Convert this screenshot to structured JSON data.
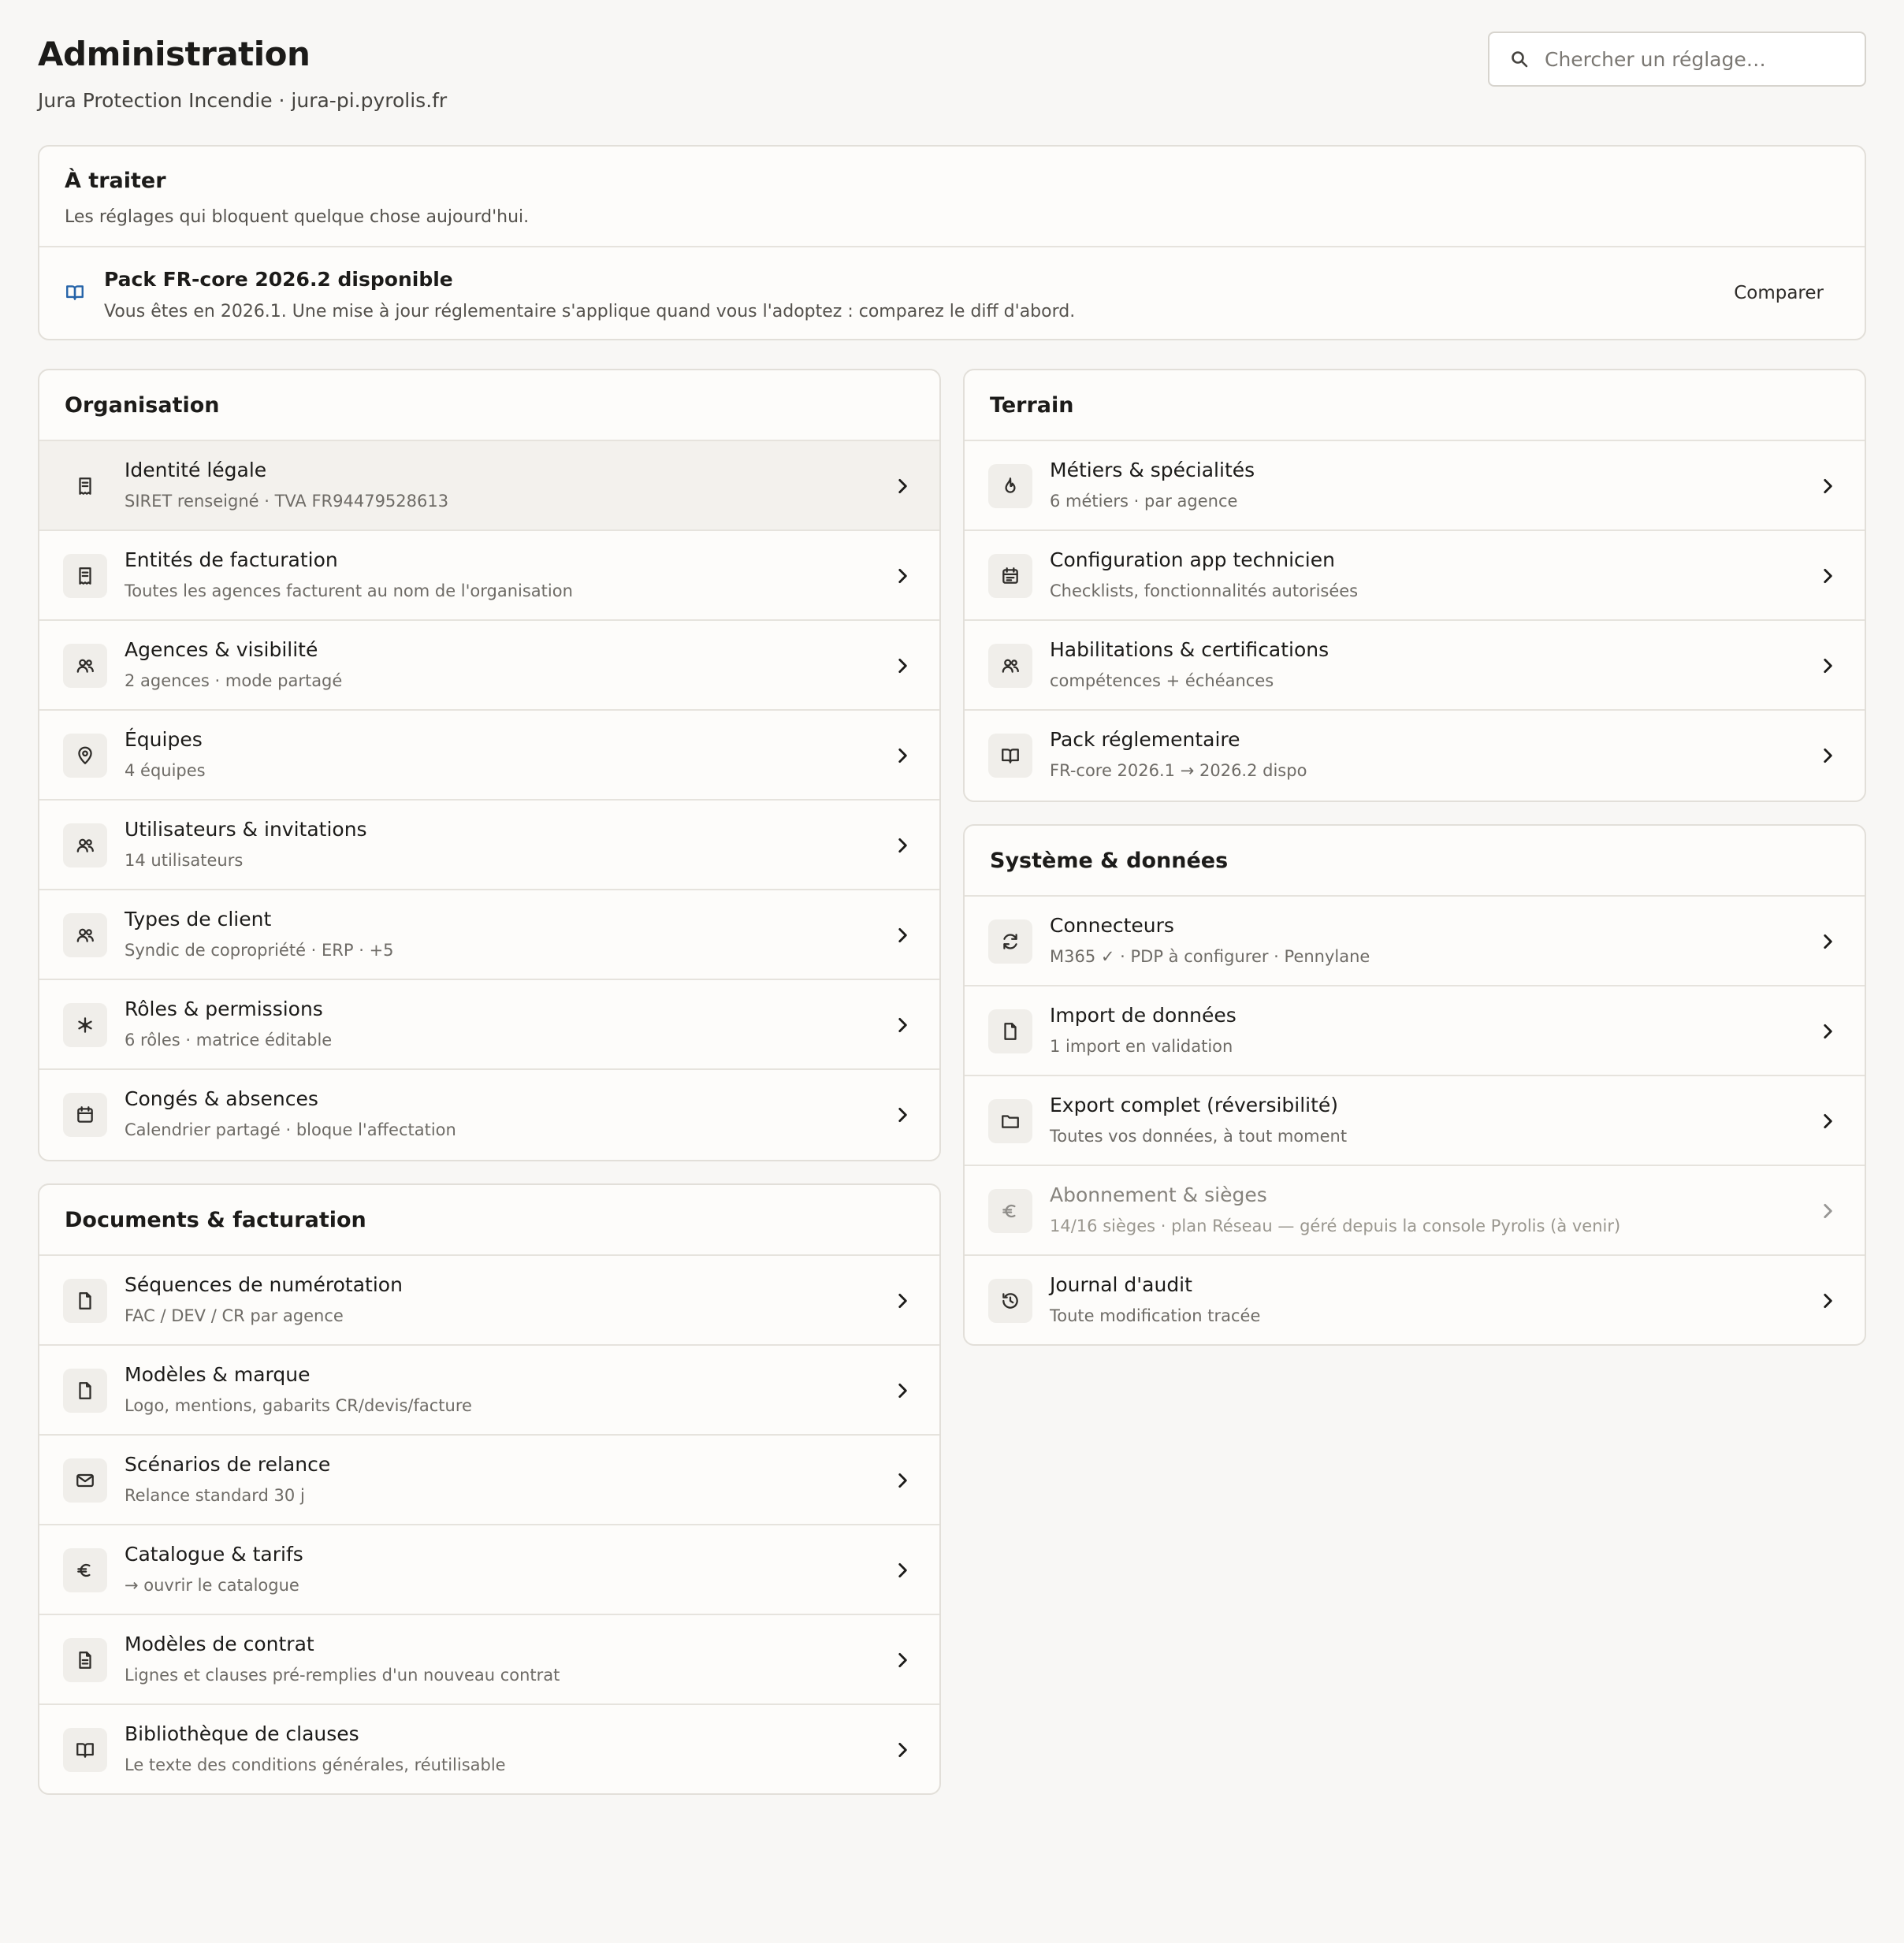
{
  "header": {
    "title": "Administration",
    "subtitle": "Jura Protection Incendie · jura-pi.pyrolis.fr"
  },
  "search": {
    "placeholder": "Chercher un réglage…",
    "icon": "search-icon"
  },
  "colors": {
    "accent": "#2563a8",
    "background": "#f8f7f5",
    "card": "#fdfcfa",
    "border": "#e2dfd9"
  },
  "todo": {
    "title": "À traiter",
    "description": "Les réglages qui bloquent quelque chose aujourd'hui.",
    "item": {
      "icon": "book-open-icon",
      "title": "Pack FR-core 2026.2 disponible",
      "description": "Vous êtes en 2026.1. Une mise à jour réglementaire s'applique quand vous l'adoptez : comparez le diff d'abord.",
      "action_label": "Comparer"
    }
  },
  "organisation": {
    "title": "Organisation",
    "items": [
      {
        "icon": "receipt-icon",
        "title": "Identité légale",
        "subtitle": "SIRET renseigné · TVA FR94479528613"
      },
      {
        "icon": "receipt-icon",
        "title": "Entités de facturation",
        "subtitle": "Toutes les agences facturent au nom de l'organisation"
      },
      {
        "icon": "users-icon",
        "title": "Agences & visibilité",
        "subtitle": "2 agences · mode partagé"
      },
      {
        "icon": "map-pin-icon",
        "title": "Équipes",
        "subtitle": "4 équipes"
      },
      {
        "icon": "users-icon",
        "title": "Utilisateurs & invitations",
        "subtitle": "14 utilisateurs"
      },
      {
        "icon": "users-icon",
        "title": "Types de client",
        "subtitle": "Syndic de copropriété · ERP · +5"
      },
      {
        "icon": "asterisk-icon",
        "title": "Rôles & permissions",
        "subtitle": "6 rôles · matrice éditable"
      },
      {
        "icon": "calendar-icon",
        "title": "Congés & absences",
        "subtitle": "Calendrier partagé · bloque l'affectation"
      }
    ]
  },
  "documents": {
    "title": "Documents & facturation",
    "items": [
      {
        "icon": "file-icon",
        "title": "Séquences de numérotation",
        "subtitle": "FAC / DEV / CR par agence"
      },
      {
        "icon": "file-icon",
        "title": "Modèles & marque",
        "subtitle": "Logo, mentions, gabarits CR/devis/facture"
      },
      {
        "icon": "mail-icon",
        "title": "Scénarios de relance",
        "subtitle": "Relance standard 30 j"
      },
      {
        "icon": "euro-icon",
        "title": "Catalogue & tarifs",
        "subtitle": "→ ouvrir le catalogue"
      },
      {
        "icon": "file-text-icon",
        "title": "Modèles de contrat",
        "subtitle": "Lignes et clauses pré-remplies d'un nouveau contrat"
      },
      {
        "icon": "book-open-icon",
        "title": "Bibliothèque de clauses",
        "subtitle": "Le texte des conditions générales, réutilisable"
      }
    ]
  },
  "terrain": {
    "title": "Terrain",
    "items": [
      {
        "icon": "flame-icon",
        "title": "Métiers & spécialités",
        "subtitle": "6 métiers · par agence"
      },
      {
        "icon": "calendar-check-icon",
        "title": "Configuration app technicien",
        "subtitle": "Checklists, fonctionnalités autorisées"
      },
      {
        "icon": "users-icon",
        "title": "Habilitations & certifications",
        "subtitle": "compétences + échéances"
      },
      {
        "icon": "book-open-icon",
        "title": "Pack réglementaire",
        "subtitle": "FR-core 2026.1 → 2026.2 dispo"
      }
    ]
  },
  "systeme": {
    "title": "Système & données",
    "items": [
      {
        "icon": "sync-icon",
        "title": "Connecteurs",
        "subtitle": "M365 ✓ · PDP à configurer · Pennylane"
      },
      {
        "icon": "file-icon",
        "title": "Import de données",
        "subtitle": "1 import en validation"
      },
      {
        "icon": "folder-icon",
        "title": "Export complet (réversibilité)",
        "subtitle": "Toutes vos données, à tout moment"
      },
      {
        "icon": "euro-icon",
        "title": "Abonnement & sièges",
        "subtitle": "14/16 sièges · plan Réseau — géré depuis la console Pyrolis (à venir)"
      },
      {
        "icon": "history-icon",
        "title": "Journal d'audit",
        "subtitle": "Toute modification tracée"
      }
    ]
  }
}
